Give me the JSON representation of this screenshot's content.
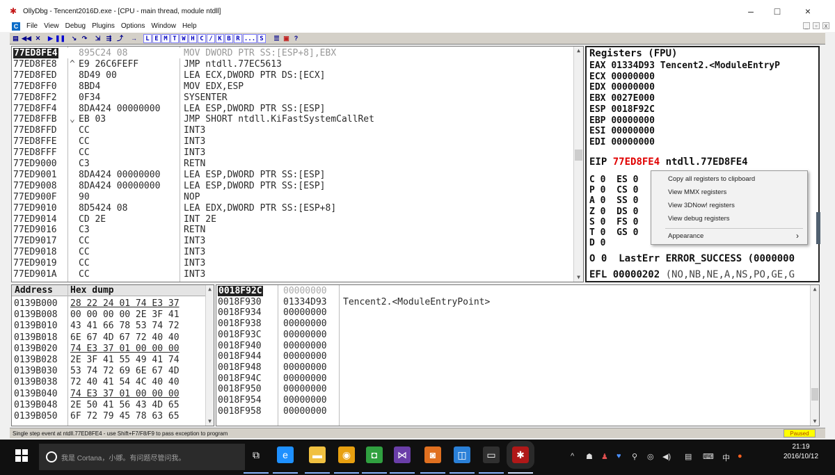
{
  "window": {
    "title": "OllyDbg - Tencent2016D.exe - [CPU - main thread, module ntdll]",
    "controls": {
      "minimize": "–",
      "maximize": "□",
      "close": "×"
    }
  },
  "menu": {
    "logo": "C",
    "items": [
      "File",
      "View",
      "Debug",
      "Plugins",
      "Options",
      "Window",
      "Help"
    ],
    "mdi": [
      "_",
      "▫",
      "x"
    ]
  },
  "toolbar": {
    "icons": [
      "open-icon",
      "restart-icon",
      "close-process-icon",
      "run-icon",
      "pause-icon",
      "step-into-icon",
      "step-over-icon",
      "trace-into-icon",
      "trace-over-icon",
      "execute-till-return-icon",
      "goto-icon"
    ],
    "icon_glyphs": [
      "▤",
      "◀◀",
      "✕",
      "▶",
      "❚❚",
      "↘",
      "↷",
      "⇲",
      "⇶",
      "⤴",
      "→"
    ],
    "letters": [
      "L",
      "E",
      "M",
      "T",
      "W",
      "H",
      "C",
      "/",
      "K",
      "B",
      "R",
      "...",
      "S"
    ],
    "extra": [
      "☰",
      "▣",
      "?"
    ]
  },
  "disasm": {
    "rows": [
      {
        "addr": "77ED8FE4",
        "mark": " ",
        "hex": "895C24 08",
        "asm": "MOV DWORD PTR SS:[ESP+8],EBX",
        "selected": true
      },
      {
        "addr": "77ED8FE8",
        "mark": "^",
        "hex": "E9 26C6FEFF",
        "asm": "JMP ntdll.77EC5613"
      },
      {
        "addr": "77ED8FED",
        "mark": " ",
        "hex": "8D49 00",
        "asm": "LEA ECX,DWORD PTR DS:[ECX]"
      },
      {
        "addr": "77ED8FF0",
        "mark": " ",
        "hex": "8BD4",
        "asm": "MOV EDX,ESP"
      },
      {
        "addr": "77ED8FF2",
        "mark": " ",
        "hex": "0F34",
        "asm": "SYSENTER"
      },
      {
        "addr": "77ED8FF4",
        "mark": " ",
        "hex": "8DA424 00000000",
        "asm": "LEA ESP,DWORD PTR SS:[ESP]"
      },
      {
        "addr": "77ED8FFB",
        "mark": "⌄",
        "hex": "EB 03",
        "asm": "JMP SHORT ntdll.KiFastSystemCallRet"
      },
      {
        "addr": "77ED8FFD",
        "mark": " ",
        "hex": "CC",
        "asm": "INT3"
      },
      {
        "addr": "77ED8FFE",
        "mark": " ",
        "hex": "CC",
        "asm": "INT3"
      },
      {
        "addr": "77ED8FFF",
        "mark": " ",
        "hex": "CC",
        "asm": "INT3"
      },
      {
        "addr": "77ED9000",
        "mark": " ",
        "hex": "C3",
        "asm": "RETN"
      },
      {
        "addr": "77ED9001",
        "mark": " ",
        "hex": "8DA424 00000000",
        "asm": "LEA ESP,DWORD PTR SS:[ESP]"
      },
      {
        "addr": "77ED9008",
        "mark": " ",
        "hex": "8DA424 00000000",
        "asm": "LEA ESP,DWORD PTR SS:[ESP]"
      },
      {
        "addr": "77ED900F",
        "mark": " ",
        "hex": "90",
        "asm": "NOP"
      },
      {
        "addr": "77ED9010",
        "mark": " ",
        "hex": "8D5424 08",
        "asm": "LEA EDX,DWORD PTR SS:[ESP+8]"
      },
      {
        "addr": "77ED9014",
        "mark": " ",
        "hex": "CD 2E",
        "asm": "INT 2E"
      },
      {
        "addr": "77ED9016",
        "mark": " ",
        "hex": "C3",
        "asm": "RETN"
      },
      {
        "addr": "77ED9017",
        "mark": " ",
        "hex": "CC",
        "asm": "INT3"
      },
      {
        "addr": "77ED9018",
        "mark": " ",
        "hex": "CC",
        "asm": "INT3"
      },
      {
        "addr": "77ED9019",
        "mark": " ",
        "hex": "CC",
        "asm": "INT3"
      },
      {
        "addr": "77ED901A",
        "mark": " ",
        "hex": "CC",
        "asm": "INT3"
      }
    ]
  },
  "registers": {
    "header": "Registers (FPU)",
    "gp": [
      {
        "name": "EAX",
        "value": "01334D93",
        "comment": "Tencent2.<ModuleEntryP"
      },
      {
        "name": "ECX",
        "value": "00000000",
        "comment": ""
      },
      {
        "name": "EDX",
        "value": "00000000",
        "comment": ""
      },
      {
        "name": "EBX",
        "value": "0027E000",
        "comment": ""
      },
      {
        "name": "ESP",
        "value": "0018F92C",
        "comment": ""
      },
      {
        "name": "EBP",
        "value": "00000000",
        "comment": ""
      },
      {
        "name": "ESI",
        "value": "00000000",
        "comment": ""
      },
      {
        "name": "EDI",
        "value": "00000000",
        "comment": ""
      }
    ],
    "eip": {
      "name": "EIP",
      "value": "77ED8FE4",
      "comment": "ntdll.77ED8FE4"
    },
    "flags": [
      {
        "flag": "C 0",
        "seg": "ES 0"
      },
      {
        "flag": "P 0",
        "seg": "CS 0"
      },
      {
        "flag": "A 0",
        "seg": "SS 0"
      },
      {
        "flag": "Z 0",
        "seg": "DS 0"
      },
      {
        "flag": "S 0",
        "seg": "FS 0"
      },
      {
        "flag": "T 0",
        "seg": "GS 0"
      },
      {
        "flag": "D 0",
        "seg": ""
      }
    ],
    "lasterr": {
      "flag": "O 0",
      "label": "LastErr",
      "value": "ERROR_SUCCESS (0000000"
    },
    "efl": {
      "name": "EFL",
      "value": "00000202",
      "comment": "(NO,NB,NE,A,NS,PO,GE,G"
    }
  },
  "context_menu": {
    "items": [
      "Copy all registers to clipboard",
      "View MMX registers",
      "View 3DNow! registers",
      "View debug registers"
    ],
    "appearance": "Appearance",
    "submenu_arrow": "›"
  },
  "dump": {
    "headers": {
      "address": "Address",
      "hex": "Hex dump"
    },
    "rows": [
      {
        "addr": "0139B000",
        "hex": "28 22 24 01 74 E3 37",
        "ul": true
      },
      {
        "addr": "0139B008",
        "hex": "00 00 00 00 2E 3F 41",
        "ul": false
      },
      {
        "addr": "0139B010",
        "hex": "43 41 66 78 53 74 72",
        "ul": false
      },
      {
        "addr": "0139B018",
        "hex": "6E 67 4D 67 72 40 40",
        "ul": false
      },
      {
        "addr": "0139B020",
        "hex": "74 E3 37 01 00 00 00",
        "ul": true
      },
      {
        "addr": "0139B028",
        "hex": "2E 3F 41 55 49 41 74",
        "ul": false
      },
      {
        "addr": "0139B030",
        "hex": "53 74 72 69 6E 67 4D",
        "ul": false
      },
      {
        "addr": "0139B038",
        "hex": "72 40 41 54 4C 40 40",
        "ul": false
      },
      {
        "addr": "0139B040",
        "hex": "74 E3 37 01 00 00 00",
        "ul": true
      },
      {
        "addr": "0139B048",
        "hex": "2E 50 41 56 43 4D 65",
        "ul": false
      },
      {
        "addr": "0139B050",
        "hex": "6F 72 79 45 78 63 65",
        "ul": false
      }
    ]
  },
  "stack": {
    "rows": [
      {
        "addr": "0018F92C",
        "value": "00000000",
        "comment": "",
        "selected": true
      },
      {
        "addr": "0018F930",
        "value": "01334D93",
        "comment": "Tencent2.<ModuleEntryPoint>"
      },
      {
        "addr": "0018F934",
        "value": "00000000",
        "comment": ""
      },
      {
        "addr": "0018F938",
        "value": "00000000",
        "comment": ""
      },
      {
        "addr": "0018F93C",
        "value": "00000000",
        "comment": ""
      },
      {
        "addr": "0018F940",
        "value": "00000000",
        "comment": ""
      },
      {
        "addr": "0018F944",
        "value": "00000000",
        "comment": ""
      },
      {
        "addr": "0018F948",
        "value": "00000000",
        "comment": ""
      },
      {
        "addr": "0018F94C",
        "value": "00000000",
        "comment": ""
      },
      {
        "addr": "0018F950",
        "value": "00000000",
        "comment": ""
      },
      {
        "addr": "0018F954",
        "value": "00000000",
        "comment": ""
      },
      {
        "addr": "0018F958",
        "value": "00000000",
        "comment": ""
      }
    ]
  },
  "status": {
    "message": "Single step event at ntdll.77ED8FE4 - use Shift+F7/F8/F9 to pass exception to program",
    "state": "Paused"
  },
  "taskbar": {
    "search_placeholder": "我是 Cortana，小娜。有问题尽管问我。",
    "apps": [
      {
        "name": "task-view-icon",
        "glyph": "⧉",
        "color": "#101010",
        "active": false
      },
      {
        "name": "edge-icon",
        "glyph": "e",
        "color": "#1e90ff",
        "active": false
      },
      {
        "name": "file-explorer-icon",
        "glyph": "▬",
        "color": "#f0c040",
        "active": false
      },
      {
        "name": "chrome-icon",
        "glyph": "◉",
        "color": "#e8a010",
        "active": false
      },
      {
        "name": "app-green-icon",
        "glyph": "◘",
        "color": "#30a040",
        "active": false
      },
      {
        "name": "visual-studio-icon",
        "glyph": "⋈",
        "color": "#6a3ea8",
        "active": false
      },
      {
        "name": "app-orange-icon",
        "glyph": "◙",
        "color": "#e07020",
        "active": false
      },
      {
        "name": "app-blue-icon",
        "glyph": "◫",
        "color": "#2a80d8",
        "active": false
      },
      {
        "name": "terminal-icon",
        "glyph": "▭",
        "color": "#303030",
        "active": false
      },
      {
        "name": "ollydbg-icon",
        "glyph": "✱",
        "color": "#b01818",
        "active": true
      }
    ],
    "tray_icons": [
      "^",
      "☗",
      "♟",
      "♥",
      "⚲",
      "◎",
      "◀)",
      "▤",
      "⌨"
    ],
    "ime": "中",
    "time": "21:19",
    "date": "2016/10/12"
  }
}
